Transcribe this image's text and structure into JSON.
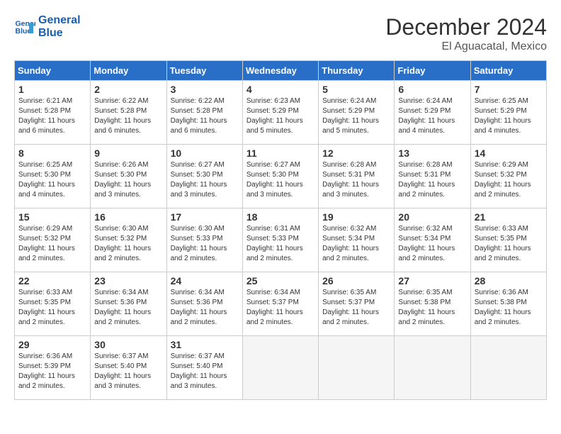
{
  "header": {
    "logo_line1": "General",
    "logo_line2": "Blue",
    "month": "December 2024",
    "location": "El Aguacatal, Mexico"
  },
  "weekdays": [
    "Sunday",
    "Monday",
    "Tuesday",
    "Wednesday",
    "Thursday",
    "Friday",
    "Saturday"
  ],
  "weeks": [
    [
      {
        "day": "1",
        "info": "Sunrise: 6:21 AM\nSunset: 5:28 PM\nDaylight: 11 hours\nand 6 minutes."
      },
      {
        "day": "2",
        "info": "Sunrise: 6:22 AM\nSunset: 5:28 PM\nDaylight: 11 hours\nand 6 minutes."
      },
      {
        "day": "3",
        "info": "Sunrise: 6:22 AM\nSunset: 5:28 PM\nDaylight: 11 hours\nand 6 minutes."
      },
      {
        "day": "4",
        "info": "Sunrise: 6:23 AM\nSunset: 5:29 PM\nDaylight: 11 hours\nand 5 minutes."
      },
      {
        "day": "5",
        "info": "Sunrise: 6:24 AM\nSunset: 5:29 PM\nDaylight: 11 hours\nand 5 minutes."
      },
      {
        "day": "6",
        "info": "Sunrise: 6:24 AM\nSunset: 5:29 PM\nDaylight: 11 hours\nand 4 minutes."
      },
      {
        "day": "7",
        "info": "Sunrise: 6:25 AM\nSunset: 5:29 PM\nDaylight: 11 hours\nand 4 minutes."
      }
    ],
    [
      {
        "day": "8",
        "info": "Sunrise: 6:25 AM\nSunset: 5:30 PM\nDaylight: 11 hours\nand 4 minutes."
      },
      {
        "day": "9",
        "info": "Sunrise: 6:26 AM\nSunset: 5:30 PM\nDaylight: 11 hours\nand 3 minutes."
      },
      {
        "day": "10",
        "info": "Sunrise: 6:27 AM\nSunset: 5:30 PM\nDaylight: 11 hours\nand 3 minutes."
      },
      {
        "day": "11",
        "info": "Sunrise: 6:27 AM\nSunset: 5:30 PM\nDaylight: 11 hours\nand 3 minutes."
      },
      {
        "day": "12",
        "info": "Sunrise: 6:28 AM\nSunset: 5:31 PM\nDaylight: 11 hours\nand 3 minutes."
      },
      {
        "day": "13",
        "info": "Sunrise: 6:28 AM\nSunset: 5:31 PM\nDaylight: 11 hours\nand 2 minutes."
      },
      {
        "day": "14",
        "info": "Sunrise: 6:29 AM\nSunset: 5:32 PM\nDaylight: 11 hours\nand 2 minutes."
      }
    ],
    [
      {
        "day": "15",
        "info": "Sunrise: 6:29 AM\nSunset: 5:32 PM\nDaylight: 11 hours\nand 2 minutes."
      },
      {
        "day": "16",
        "info": "Sunrise: 6:30 AM\nSunset: 5:32 PM\nDaylight: 11 hours\nand 2 minutes."
      },
      {
        "day": "17",
        "info": "Sunrise: 6:30 AM\nSunset: 5:33 PM\nDaylight: 11 hours\nand 2 minutes."
      },
      {
        "day": "18",
        "info": "Sunrise: 6:31 AM\nSunset: 5:33 PM\nDaylight: 11 hours\nand 2 minutes."
      },
      {
        "day": "19",
        "info": "Sunrise: 6:32 AM\nSunset: 5:34 PM\nDaylight: 11 hours\nand 2 minutes."
      },
      {
        "day": "20",
        "info": "Sunrise: 6:32 AM\nSunset: 5:34 PM\nDaylight: 11 hours\nand 2 minutes."
      },
      {
        "day": "21",
        "info": "Sunrise: 6:33 AM\nSunset: 5:35 PM\nDaylight: 11 hours\nand 2 minutes."
      }
    ],
    [
      {
        "day": "22",
        "info": "Sunrise: 6:33 AM\nSunset: 5:35 PM\nDaylight: 11 hours\nand 2 minutes."
      },
      {
        "day": "23",
        "info": "Sunrise: 6:34 AM\nSunset: 5:36 PM\nDaylight: 11 hours\nand 2 minutes."
      },
      {
        "day": "24",
        "info": "Sunrise: 6:34 AM\nSunset: 5:36 PM\nDaylight: 11 hours\nand 2 minutes."
      },
      {
        "day": "25",
        "info": "Sunrise: 6:34 AM\nSunset: 5:37 PM\nDaylight: 11 hours\nand 2 minutes."
      },
      {
        "day": "26",
        "info": "Sunrise: 6:35 AM\nSunset: 5:37 PM\nDaylight: 11 hours\nand 2 minutes."
      },
      {
        "day": "27",
        "info": "Sunrise: 6:35 AM\nSunset: 5:38 PM\nDaylight: 11 hours\nand 2 minutes."
      },
      {
        "day": "28",
        "info": "Sunrise: 6:36 AM\nSunset: 5:38 PM\nDaylight: 11 hours\nand 2 minutes."
      }
    ],
    [
      {
        "day": "29",
        "info": "Sunrise: 6:36 AM\nSunset: 5:39 PM\nDaylight: 11 hours\nand 2 minutes."
      },
      {
        "day": "30",
        "info": "Sunrise: 6:37 AM\nSunset: 5:40 PM\nDaylight: 11 hours\nand 3 minutes."
      },
      {
        "day": "31",
        "info": "Sunrise: 6:37 AM\nSunset: 5:40 PM\nDaylight: 11 hours\nand 3 minutes."
      },
      null,
      null,
      null,
      null
    ]
  ]
}
